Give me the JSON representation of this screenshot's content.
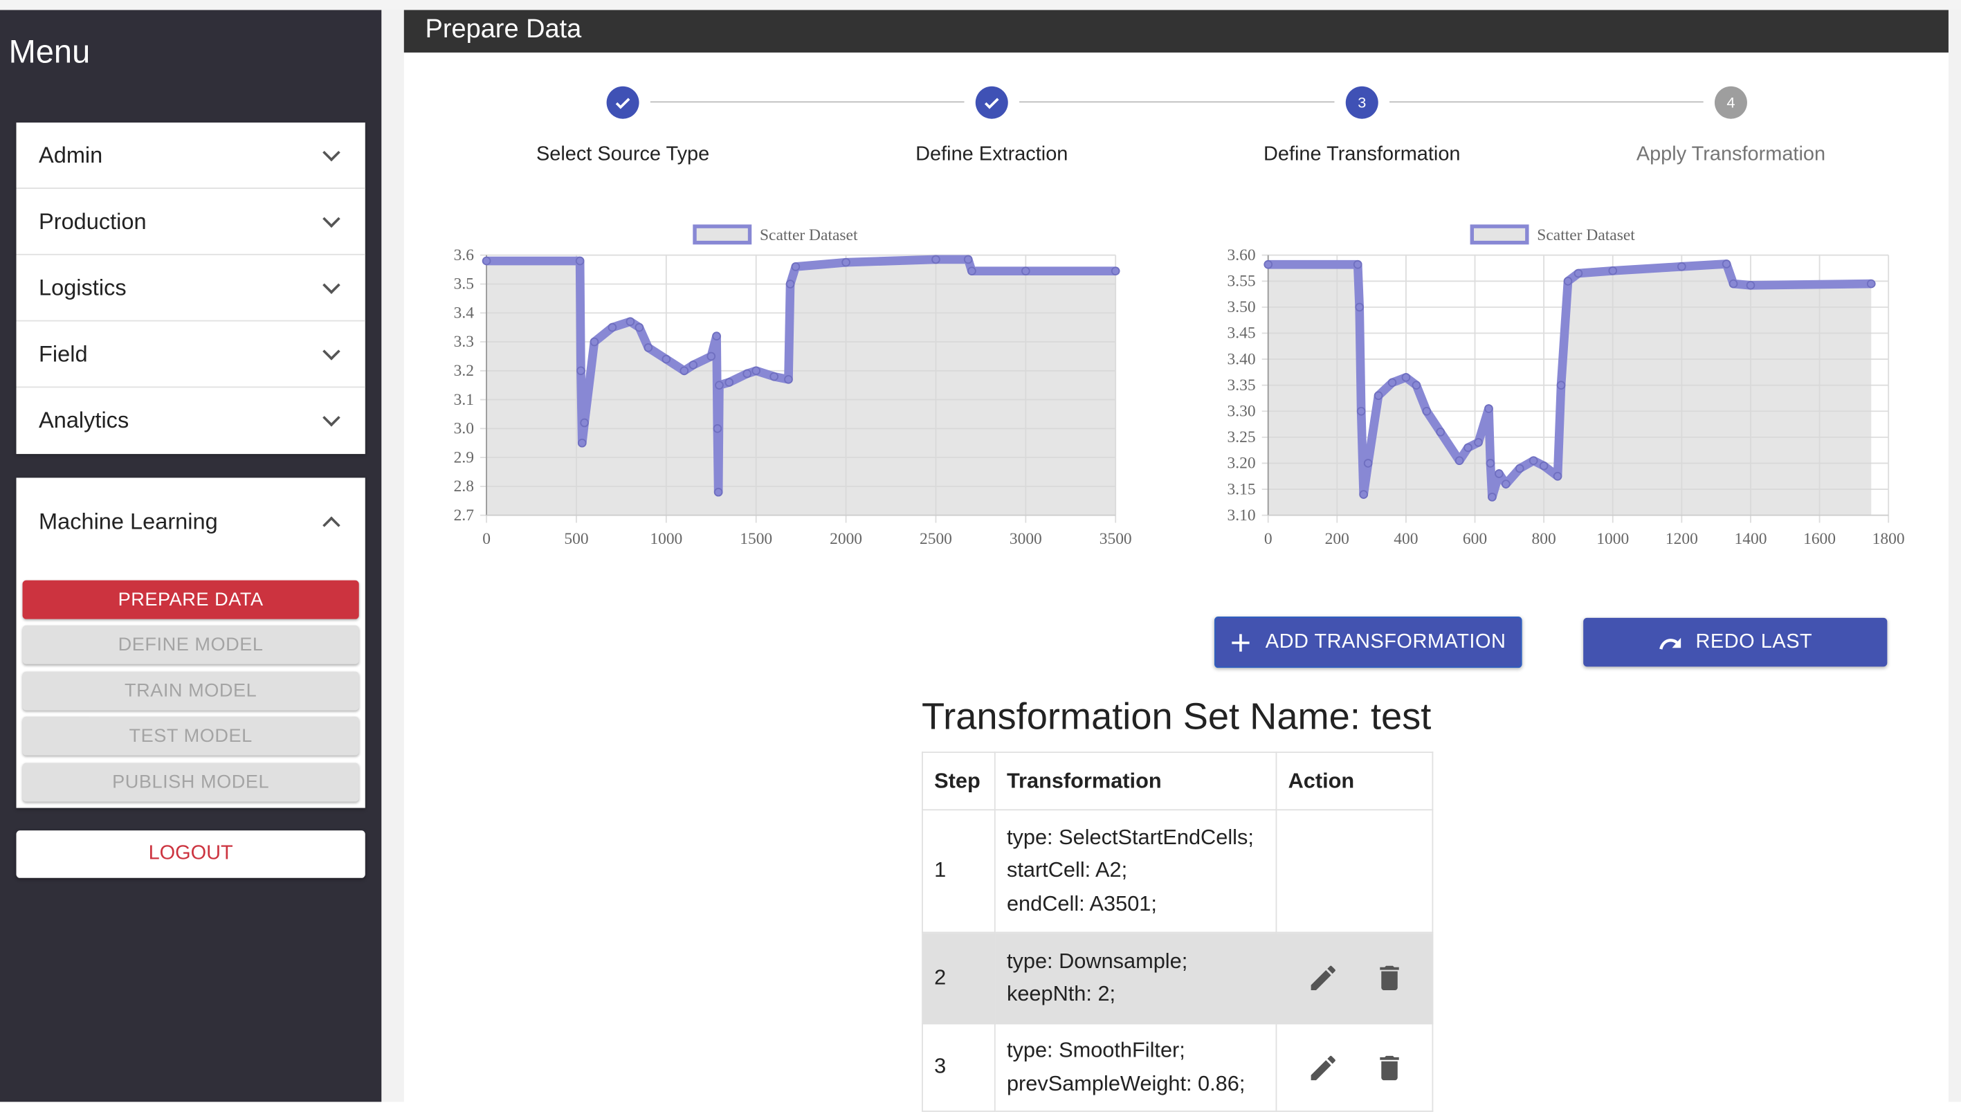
{
  "sidebar": {
    "title": "Menu",
    "sections": [
      {
        "label": "Admin",
        "expanded": false
      },
      {
        "label": "Production",
        "expanded": false
      },
      {
        "label": "Logistics",
        "expanded": false
      },
      {
        "label": "Field",
        "expanded": false
      },
      {
        "label": "Analytics",
        "expanded": false
      }
    ],
    "ml": {
      "label": "Machine Learning",
      "expanded": true,
      "buttons": [
        {
          "label": "PREPARE DATA",
          "state": "active"
        },
        {
          "label": "DEFINE MODEL",
          "state": "disabled"
        },
        {
          "label": "TRAIN MODEL",
          "state": "disabled"
        },
        {
          "label": "TEST MODEL",
          "state": "disabled"
        },
        {
          "label": "PUBLISH MODEL",
          "state": "disabled"
        }
      ]
    },
    "logout": "LOGOUT"
  },
  "header": {
    "title": "Prepare Data"
  },
  "stepper": [
    {
      "label": "Select Source Type",
      "number": "1",
      "status": "completed"
    },
    {
      "label": "Define Extraction",
      "number": "2",
      "status": "completed"
    },
    {
      "label": "Define Transformation",
      "number": "3",
      "status": "active"
    },
    {
      "label": "Apply Transformation",
      "number": "4",
      "status": "pending"
    }
  ],
  "colors": {
    "accent": "#3f51b5",
    "danger": "#cc333f",
    "series": "#8888d4",
    "fill": "#e4e4e4",
    "header": "#333333",
    "sidebar": "#302f39"
  },
  "chart_data": [
    {
      "type": "scatter",
      "legend": [
        "Scatter Dataset"
      ],
      "legend_placement": "top",
      "grid": true,
      "xlim": [
        0,
        3500
      ],
      "ylim": [
        2.7,
        3.6
      ],
      "xticks": [
        "0",
        "500",
        "1000",
        "1500",
        "2000",
        "2500",
        "3000",
        "3500"
      ],
      "yticks": [
        "3.6",
        "3.5",
        "3.4",
        "3.3",
        "3.2",
        "3.1",
        "3.0",
        "2.9",
        "2.8",
        "2.7"
      ],
      "series": [
        {
          "name": "Scatter Dataset",
          "points": [
            [
              0,
              3.58
            ],
            [
              520,
              3.58
            ],
            [
              525,
              3.2
            ],
            [
              532,
              2.95
            ],
            [
              545,
              3.02
            ],
            [
              600,
              3.3
            ],
            [
              700,
              3.35
            ],
            [
              800,
              3.37
            ],
            [
              850,
              3.35
            ],
            [
              900,
              3.28
            ],
            [
              1000,
              3.24
            ],
            [
              1100,
              3.2
            ],
            [
              1150,
              3.22
            ],
            [
              1250,
              3.25
            ],
            [
              1280,
              3.32
            ],
            [
              1285,
              3.0
            ],
            [
              1290,
              2.78
            ],
            [
              1295,
              3.15
            ],
            [
              1350,
              3.16
            ],
            [
              1450,
              3.19
            ],
            [
              1500,
              3.2
            ],
            [
              1600,
              3.18
            ],
            [
              1680,
              3.17
            ],
            [
              1690,
              3.5
            ],
            [
              1720,
              3.56
            ],
            [
              2000,
              3.575
            ],
            [
              2500,
              3.585
            ],
            [
              2680,
              3.585
            ],
            [
              2700,
              3.545
            ],
            [
              3000,
              3.545
            ],
            [
              3500,
              3.545
            ]
          ]
        }
      ]
    },
    {
      "type": "scatter",
      "legend": [
        "Scatter Dataset"
      ],
      "legend_placement": "top",
      "grid": true,
      "xlim": [
        0,
        1800
      ],
      "ylim": [
        3.1,
        3.6
      ],
      "xticks": [
        "0",
        "200",
        "400",
        "600",
        "800",
        "1000",
        "1200",
        "1400",
        "1600",
        "1800"
      ],
      "yticks": [
        "3.60",
        "3.55",
        "3.50",
        "3.45",
        "3.40",
        "3.35",
        "3.30",
        "3.25",
        "3.20",
        "3.15",
        "3.10"
      ],
      "series": [
        {
          "name": "Scatter Dataset",
          "points": [
            [
              0,
              3.582
            ],
            [
              260,
              3.582
            ],
            [
              265,
              3.5
            ],
            [
              270,
              3.3
            ],
            [
              277,
              3.14
            ],
            [
              290,
              3.2
            ],
            [
              320,
              3.33
            ],
            [
              360,
              3.355
            ],
            [
              400,
              3.365
            ],
            [
              430,
              3.35
            ],
            [
              460,
              3.3
            ],
            [
              500,
              3.26
            ],
            [
              555,
              3.205
            ],
            [
              580,
              3.23
            ],
            [
              610,
              3.24
            ],
            [
              640,
              3.305
            ],
            [
              645,
              3.2
            ],
            [
              650,
              3.135
            ],
            [
              670,
              3.18
            ],
            [
              690,
              3.16
            ],
            [
              730,
              3.19
            ],
            [
              770,
              3.205
            ],
            [
              800,
              3.195
            ],
            [
              840,
              3.175
            ],
            [
              850,
              3.35
            ],
            [
              870,
              3.55
            ],
            [
              900,
              3.565
            ],
            [
              1000,
              3.57
            ],
            [
              1200,
              3.578
            ],
            [
              1330,
              3.583
            ],
            [
              1350,
              3.545
            ],
            [
              1400,
              3.542
            ],
            [
              1750,
              3.545
            ]
          ]
        }
      ]
    }
  ],
  "actions": {
    "add": "ADD TRANSFORMATION",
    "redo": "REDO LAST"
  },
  "transformation_set": {
    "title": "Transformation Set Name: test",
    "columns": [
      "Step",
      "Transformation",
      "Action"
    ],
    "rows": [
      {
        "step": "1",
        "lines": [
          "type: SelectStartEndCells;",
          "startCell: A2;",
          "endCell: A3501;"
        ],
        "actions": false
      },
      {
        "step": "2",
        "lines": [
          "type: Downsample;",
          "keepNth: 2;"
        ],
        "actions": true
      },
      {
        "step": "3",
        "lines": [
          "type: SmoothFilter;",
          "prevSampleWeight: 0.86;"
        ],
        "actions": true
      }
    ]
  }
}
